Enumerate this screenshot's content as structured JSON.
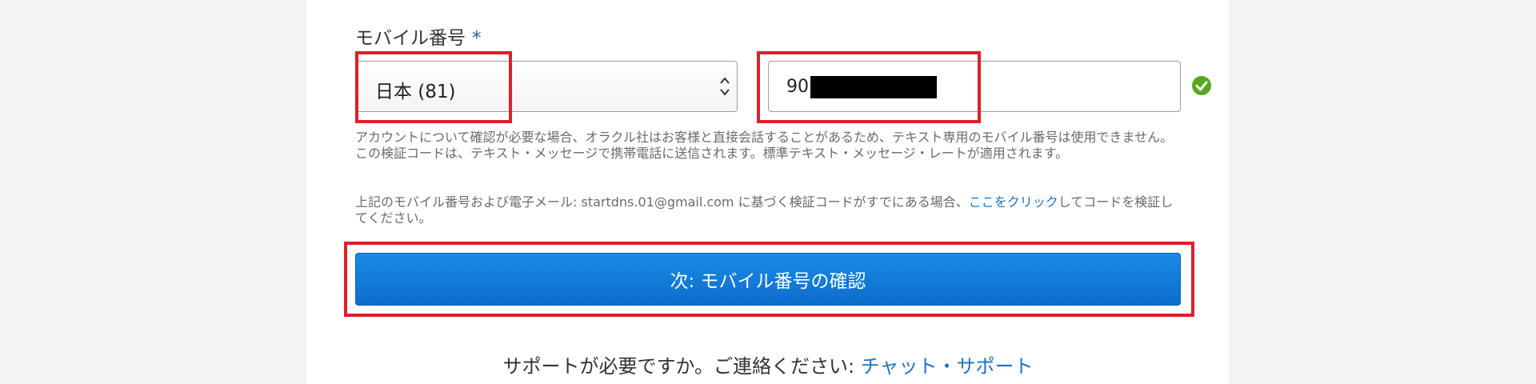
{
  "form": {
    "field_label": "モバイル番号",
    "required_mark": "*",
    "country_select": {
      "value": "日本 (81)"
    },
    "phone_input": {
      "value_prefix": "90"
    },
    "valid_icon": "check-circle-icon",
    "help_text": "アカウントについて確認が必要な場合、オラクル社はお客様と直接会話することがあるため、テキスト専用のモバイル番号は使用できません。この検証コードは、テキスト・メッセージで携帯電話に送信されます。標準テキスト・メッセージ・レートが適用されます。",
    "existing_code_text_before": "上記のモバイル番号および電子メール: startdns.01@gmail.com に基づく検証コードがすでにある場合、",
    "existing_code_link": "ここをクリック",
    "existing_code_text_after": "してコードを検証してください。",
    "submit_button": "次: モバイル番号の確認"
  },
  "support": {
    "text": "サポートが必要ですか。ご連絡ください: ",
    "link": "チャット・サポート"
  },
  "colors": {
    "accent": "#0b6dcc",
    "link": "#1a73c7",
    "highlight": "#e01e2b",
    "success": "#5aa820"
  }
}
